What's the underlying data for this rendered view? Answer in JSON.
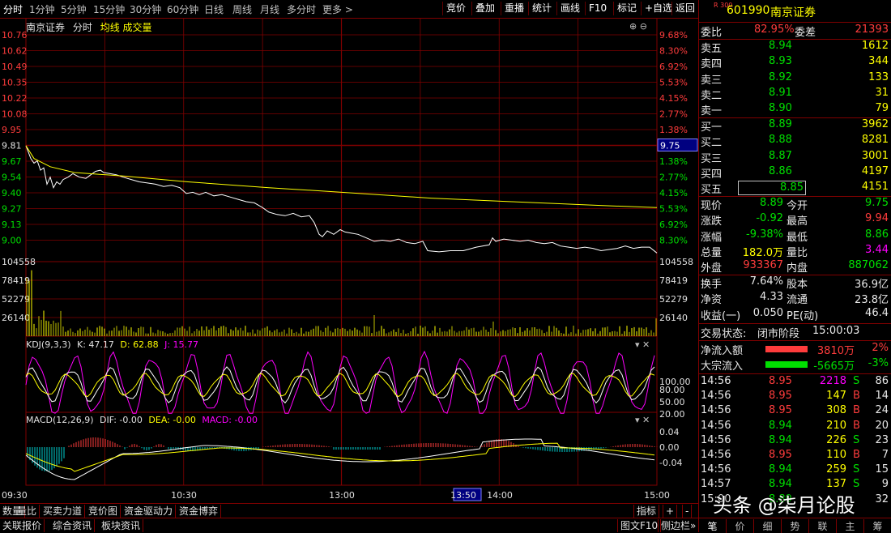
{
  "toolbar": {
    "periods": [
      "分时",
      "1分钟",
      "5分钟",
      "15分钟",
      "30分钟",
      "60分钟",
      "日线",
      "周线",
      "月线",
      "多分时",
      "更多 >"
    ],
    "right_buttons": [
      "竞价",
      "叠加",
      "重播",
      "统计",
      "画线",
      "F10",
      "标记",
      "+自选",
      "返回"
    ]
  },
  "chart_header": {
    "stock": "南京证券",
    "view": "分时",
    "avg": "均线",
    "vol": "成交量"
  },
  "price_axis": {
    "left": [
      "10.76",
      "10.62",
      "10.49",
      "10.35",
      "10.22",
      "10.08",
      "9.95",
      "9.81",
      "9.67",
      "9.54",
      "9.40",
      "9.27",
      "9.13",
      "9.00"
    ],
    "right": [
      "9.68%",
      "8.30%",
      "6.92%",
      "5.53%",
      "4.15%",
      "2.77%",
      "1.38%",
      "9.75",
      "1.38%",
      "2.77%",
      "4.15%",
      "5.53%",
      "6.92%",
      "8.30%"
    ],
    "current_marker": "9.75"
  },
  "volume_axis": {
    "left": [
      "104558",
      "78419",
      "52279",
      "26140"
    ],
    "right": [
      "104558",
      "78419",
      "52279",
      "26140"
    ]
  },
  "kdj": {
    "label": "KDJ(9,3,3)",
    "k": "K: 47.17",
    "d": "D: 62.88",
    "j": "J: 15.77",
    "axis": [
      "100.00",
      "80.00",
      "50.00",
      "20.00"
    ]
  },
  "macd": {
    "label": "MACD(12,26,9)",
    "dif": "DIF: -0.00",
    "dea": "DEA: -0.00",
    "macd": "MACD: -0.00",
    "axis": [
      "0.04",
      "0.00",
      "-0.04"
    ]
  },
  "time_axis": {
    "labels": [
      "09:30",
      "10:30",
      "13:00",
      "13:50",
      "14:00",
      "15:00"
    ]
  },
  "bottom_tabs_1": [
    "数量",
    "量比",
    "买卖力道",
    "竞价图",
    "资金驱动力",
    "资金博弈"
  ],
  "bottom_tabs_1_right": [
    "指标",
    "+",
    "-"
  ],
  "bottom_tabs_2": [
    "关联报价",
    "综合资讯",
    "板块资讯"
  ],
  "bottom_tabs_2_right": [
    "图文F10",
    "侧边栏»"
  ],
  "side_panel": {
    "badge": "R 300",
    "code": "601990",
    "name": "南京证券",
    "webi_label": "委比",
    "webi_value": "82.95%",
    "weicha_label": "委差",
    "weicha_value": "21393",
    "asks": [
      {
        "label": "卖五",
        "price": "8.94",
        "vol": "1612"
      },
      {
        "label": "卖四",
        "price": "8.93",
        "vol": "344"
      },
      {
        "label": "卖三",
        "price": "8.92",
        "vol": "133"
      },
      {
        "label": "卖二",
        "price": "8.91",
        "vol": "31"
      },
      {
        "label": "卖一",
        "price": "8.90",
        "vol": "79"
      }
    ],
    "bids": [
      {
        "label": "买一",
        "price": "8.89",
        "vol": "3962"
      },
      {
        "label": "买二",
        "price": "8.88",
        "vol": "8281"
      },
      {
        "label": "买三",
        "price": "8.87",
        "vol": "3001"
      },
      {
        "label": "买四",
        "price": "8.86",
        "vol": "4197"
      },
      {
        "label": "买五",
        "price": "8.85",
        "vol": "4151"
      }
    ],
    "quote": [
      {
        "l1": "现价",
        "v1": "8.89",
        "c1": "green",
        "l2": "今开",
        "v2": "9.75",
        "c2": "green"
      },
      {
        "l1": "涨跌",
        "v1": "-0.92",
        "c1": "green",
        "l2": "最高",
        "v2": "9.94",
        "c2": "red"
      },
      {
        "l1": "涨幅",
        "v1": "-9.38%",
        "c1": "green",
        "l2": "最低",
        "v2": "8.86",
        "c2": "green"
      },
      {
        "l1": "总量",
        "v1": "182.0万",
        "c1": "yellow",
        "l2": "量比",
        "v2": "3.44",
        "c2": "magenta"
      },
      {
        "l1": "外盘",
        "v1": "933367",
        "c1": "red",
        "l2": "内盘",
        "v2": "887062",
        "c2": "green"
      }
    ],
    "stats": [
      {
        "l1": "换手",
        "v1": "7.64%",
        "l2": "股本",
        "v2": "36.9亿"
      },
      {
        "l1": "净资",
        "v1": "4.33",
        "l2": "流通",
        "v2": "23.8亿"
      },
      {
        "l1": "收益(一)",
        "v1": "0.050",
        "l2": "PE(动)",
        "v2": "46.4"
      }
    ],
    "trade_status_label": "交易状态:",
    "trade_status": "闭市阶段",
    "trade_time": "15:00:03",
    "flow": [
      {
        "label": "净流入额",
        "value": "3810万",
        "pct": "2%",
        "color": "red"
      },
      {
        "label": "大宗流入",
        "value": "-5665万",
        "pct": "-3%",
        "color": "green"
      }
    ],
    "ticks": [
      {
        "t": "14:56",
        "p": "8.95",
        "pc": "red",
        "v": "2218",
        "vc": "magenta",
        "s": "S",
        "n": "86"
      },
      {
        "t": "14:56",
        "p": "8.95",
        "pc": "red",
        "v": "147",
        "vc": "yellow",
        "s": "B",
        "n": "14"
      },
      {
        "t": "14:56",
        "p": "8.95",
        "pc": "red",
        "v": "308",
        "vc": "yellow",
        "s": "B",
        "n": "24"
      },
      {
        "t": "14:56",
        "p": "8.94",
        "pc": "green",
        "v": "210",
        "vc": "yellow",
        "s": "B",
        "n": "20"
      },
      {
        "t": "14:56",
        "p": "8.94",
        "pc": "green",
        "v": "226",
        "vc": "yellow",
        "s": "S",
        "n": "23"
      },
      {
        "t": "14:56",
        "p": "8.95",
        "pc": "red",
        "v": "110",
        "vc": "yellow",
        "s": "B",
        "n": "7"
      },
      {
        "t": "14:56",
        "p": "8.94",
        "pc": "green",
        "v": "259",
        "vc": "yellow",
        "s": "S",
        "n": "15"
      },
      {
        "t": "14:57",
        "p": "8.94",
        "pc": "green",
        "v": "137",
        "vc": "yellow",
        "s": "S",
        "n": "9"
      },
      {
        "t": "15:00",
        "p": "8.89",
        "pc": "green",
        "v": "",
        "vc": "yellow",
        "s": "",
        "n": "32"
      }
    ],
    "footer_tabs": [
      "笔",
      "价",
      "细",
      "势",
      "联",
      "主",
      "筹"
    ]
  },
  "watermark": "头条 @柒月论股",
  "colors": {
    "grid": "#800000",
    "price": "#ffffff",
    "avg": "#ffff00",
    "rise": "#ff3c3c",
    "fall": "#00e000"
  }
}
